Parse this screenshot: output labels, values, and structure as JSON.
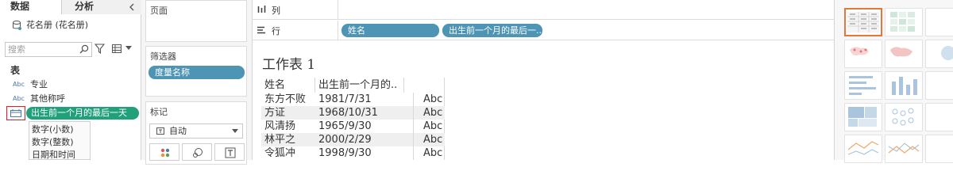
{
  "left_pane": {
    "tabs": {
      "data": "数据",
      "analytics": "分析"
    },
    "datasource": "花名册 (花名册)",
    "search": {
      "placeholder": "搜索"
    },
    "section": "表",
    "fields": [
      {
        "type_icon": "Abc",
        "label": "专业"
      },
      {
        "type_icon": "Abc",
        "label": "其他称呼"
      }
    ],
    "selected_field": {
      "label": "出生前一个月的最后一天"
    },
    "type_menu": [
      "数字(小数)",
      "数字(整数)",
      "日期和时间"
    ]
  },
  "mid_pane": {
    "pages_title": "页面",
    "filters_title": "筛选器",
    "filter_pill": "度量名称",
    "marks_title": "标记",
    "marks_type": "自动"
  },
  "main": {
    "columns_label": "列",
    "rows_label": "行",
    "row_pills": [
      "姓名",
      "出生前一个月的最后一.."
    ],
    "sheet_title": "工作表 1",
    "table": {
      "headers": [
        "姓名",
        "出生前一个月的.."
      ],
      "rows": [
        {
          "name": "东方不败",
          "date": "1981/7/31",
          "value": "Abc"
        },
        {
          "name": "方证",
          "date": "1968/10/31",
          "value": "Abc"
        },
        {
          "name": "风清扬",
          "date": "1965/9/30",
          "value": "Abc"
        },
        {
          "name": "林平之",
          "date": "2000/2/29",
          "value": "Abc"
        },
        {
          "name": "令狐冲",
          "date": "1998/9/30",
          "value": "Abc"
        }
      ]
    }
  },
  "colors": {
    "selected_field_bg": "#21a179",
    "pill_bg": "#4e94b5",
    "showme_active_border": "#e8753a",
    "highlight_box": "#e02020"
  }
}
